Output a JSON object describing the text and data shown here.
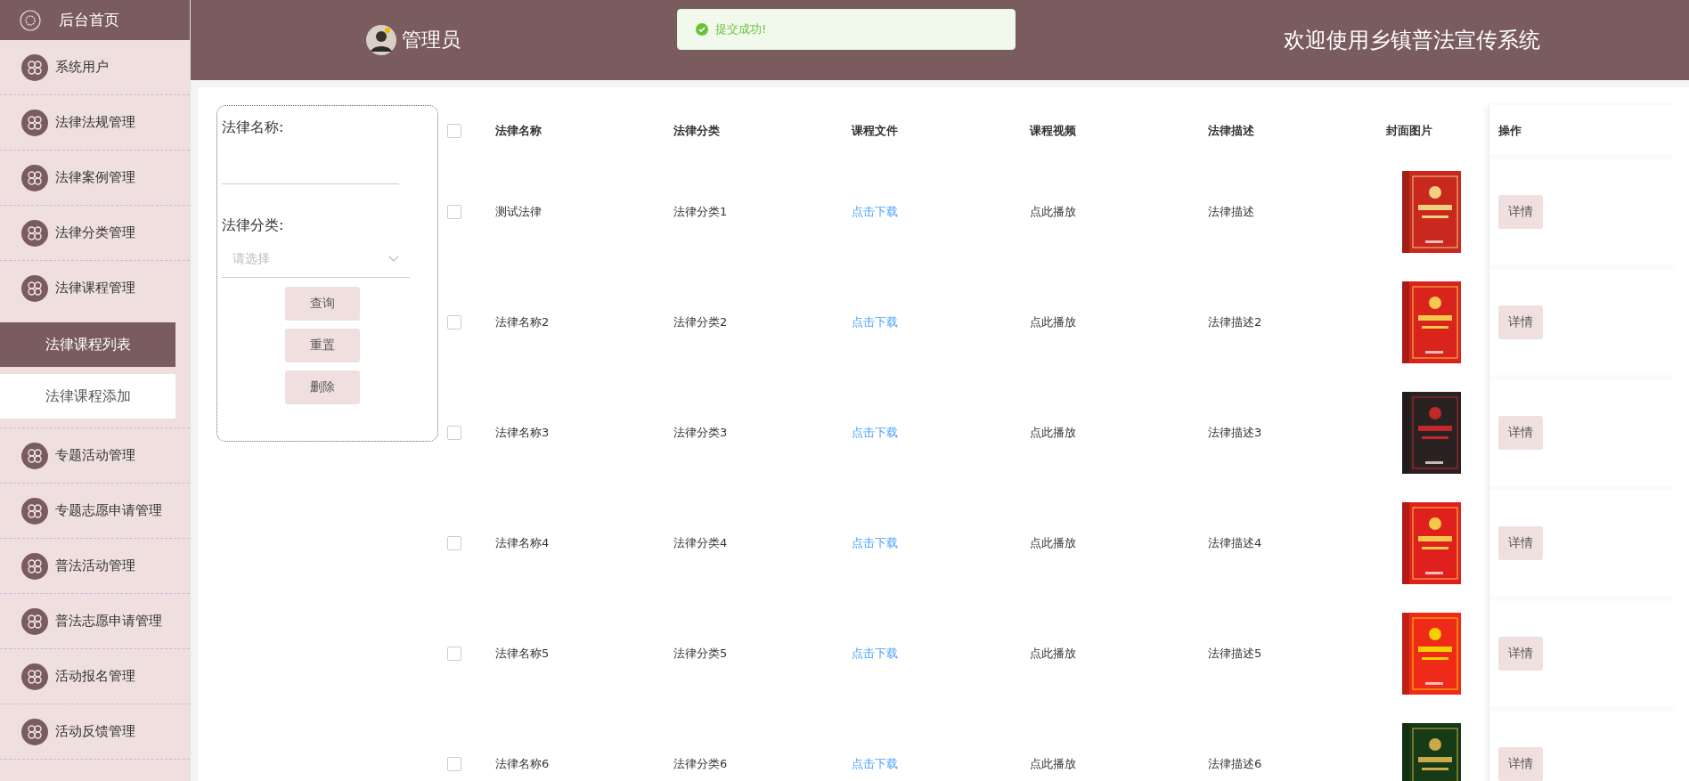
{
  "sidebar": {
    "home": "后台首页",
    "items": [
      {
        "label": "系统用户"
      },
      {
        "label": "法律法规管理"
      },
      {
        "label": "法律案例管理"
      },
      {
        "label": "法律分类管理"
      },
      {
        "label": "法律课程管理",
        "children": [
          {
            "label": "法律课程列表",
            "selected": true
          },
          {
            "label": "法律课程添加",
            "selected": false
          }
        ]
      },
      {
        "label": "专题活动管理"
      },
      {
        "label": "专题志愿申请管理"
      },
      {
        "label": "普法活动管理"
      },
      {
        "label": "普法志愿申请管理"
      },
      {
        "label": "活动报名管理"
      },
      {
        "label": "活动反馈管理"
      }
    ]
  },
  "header": {
    "user": "管理员",
    "title": "欢迎使用乡镇普法宣传系统"
  },
  "toast": {
    "message": "提交成功!"
  },
  "search": {
    "name_label": "法律名称:",
    "category_label": "法律分类:",
    "category_placeholder": "请选择",
    "buttons": [
      "查询",
      "重置",
      "删除"
    ]
  },
  "table": {
    "all_checked": false,
    "columns": [
      "法律名称",
      "法律分类",
      "课程文件",
      "课程视频",
      "法律描述",
      "封面图片",
      "操作"
    ],
    "rows": [
      {
        "checked": false,
        "name": "测试法律",
        "category": "法律分类1",
        "file": "点击下载",
        "video": "点此播放",
        "description": "法律描述",
        "action": "详情"
      },
      {
        "checked": false,
        "name": "法律名称2",
        "category": "法律分类2",
        "file": "点击下载",
        "video": "点此播放",
        "description": "法律描述2",
        "action": "详情"
      },
      {
        "checked": false,
        "name": "法律名称3",
        "category": "法律分类3",
        "file": "点击下载",
        "video": "点此播放",
        "description": "法律描述3",
        "action": "详情"
      },
      {
        "checked": false,
        "name": "法律名称4",
        "category": "法律分类4",
        "file": "点击下载",
        "video": "点此播放",
        "description": "法律描述4",
        "action": "详情"
      },
      {
        "checked": false,
        "name": "法律名称5",
        "category": "法律分类5",
        "file": "点击下载",
        "video": "点此播放",
        "description": "法律描述5",
        "action": "详情"
      },
      {
        "checked": false,
        "name": "法律名称6",
        "category": "法律分类6",
        "file": "点击下载",
        "video": "点此播放",
        "description": "法律描述6",
        "action": "详情"
      }
    ]
  }
}
